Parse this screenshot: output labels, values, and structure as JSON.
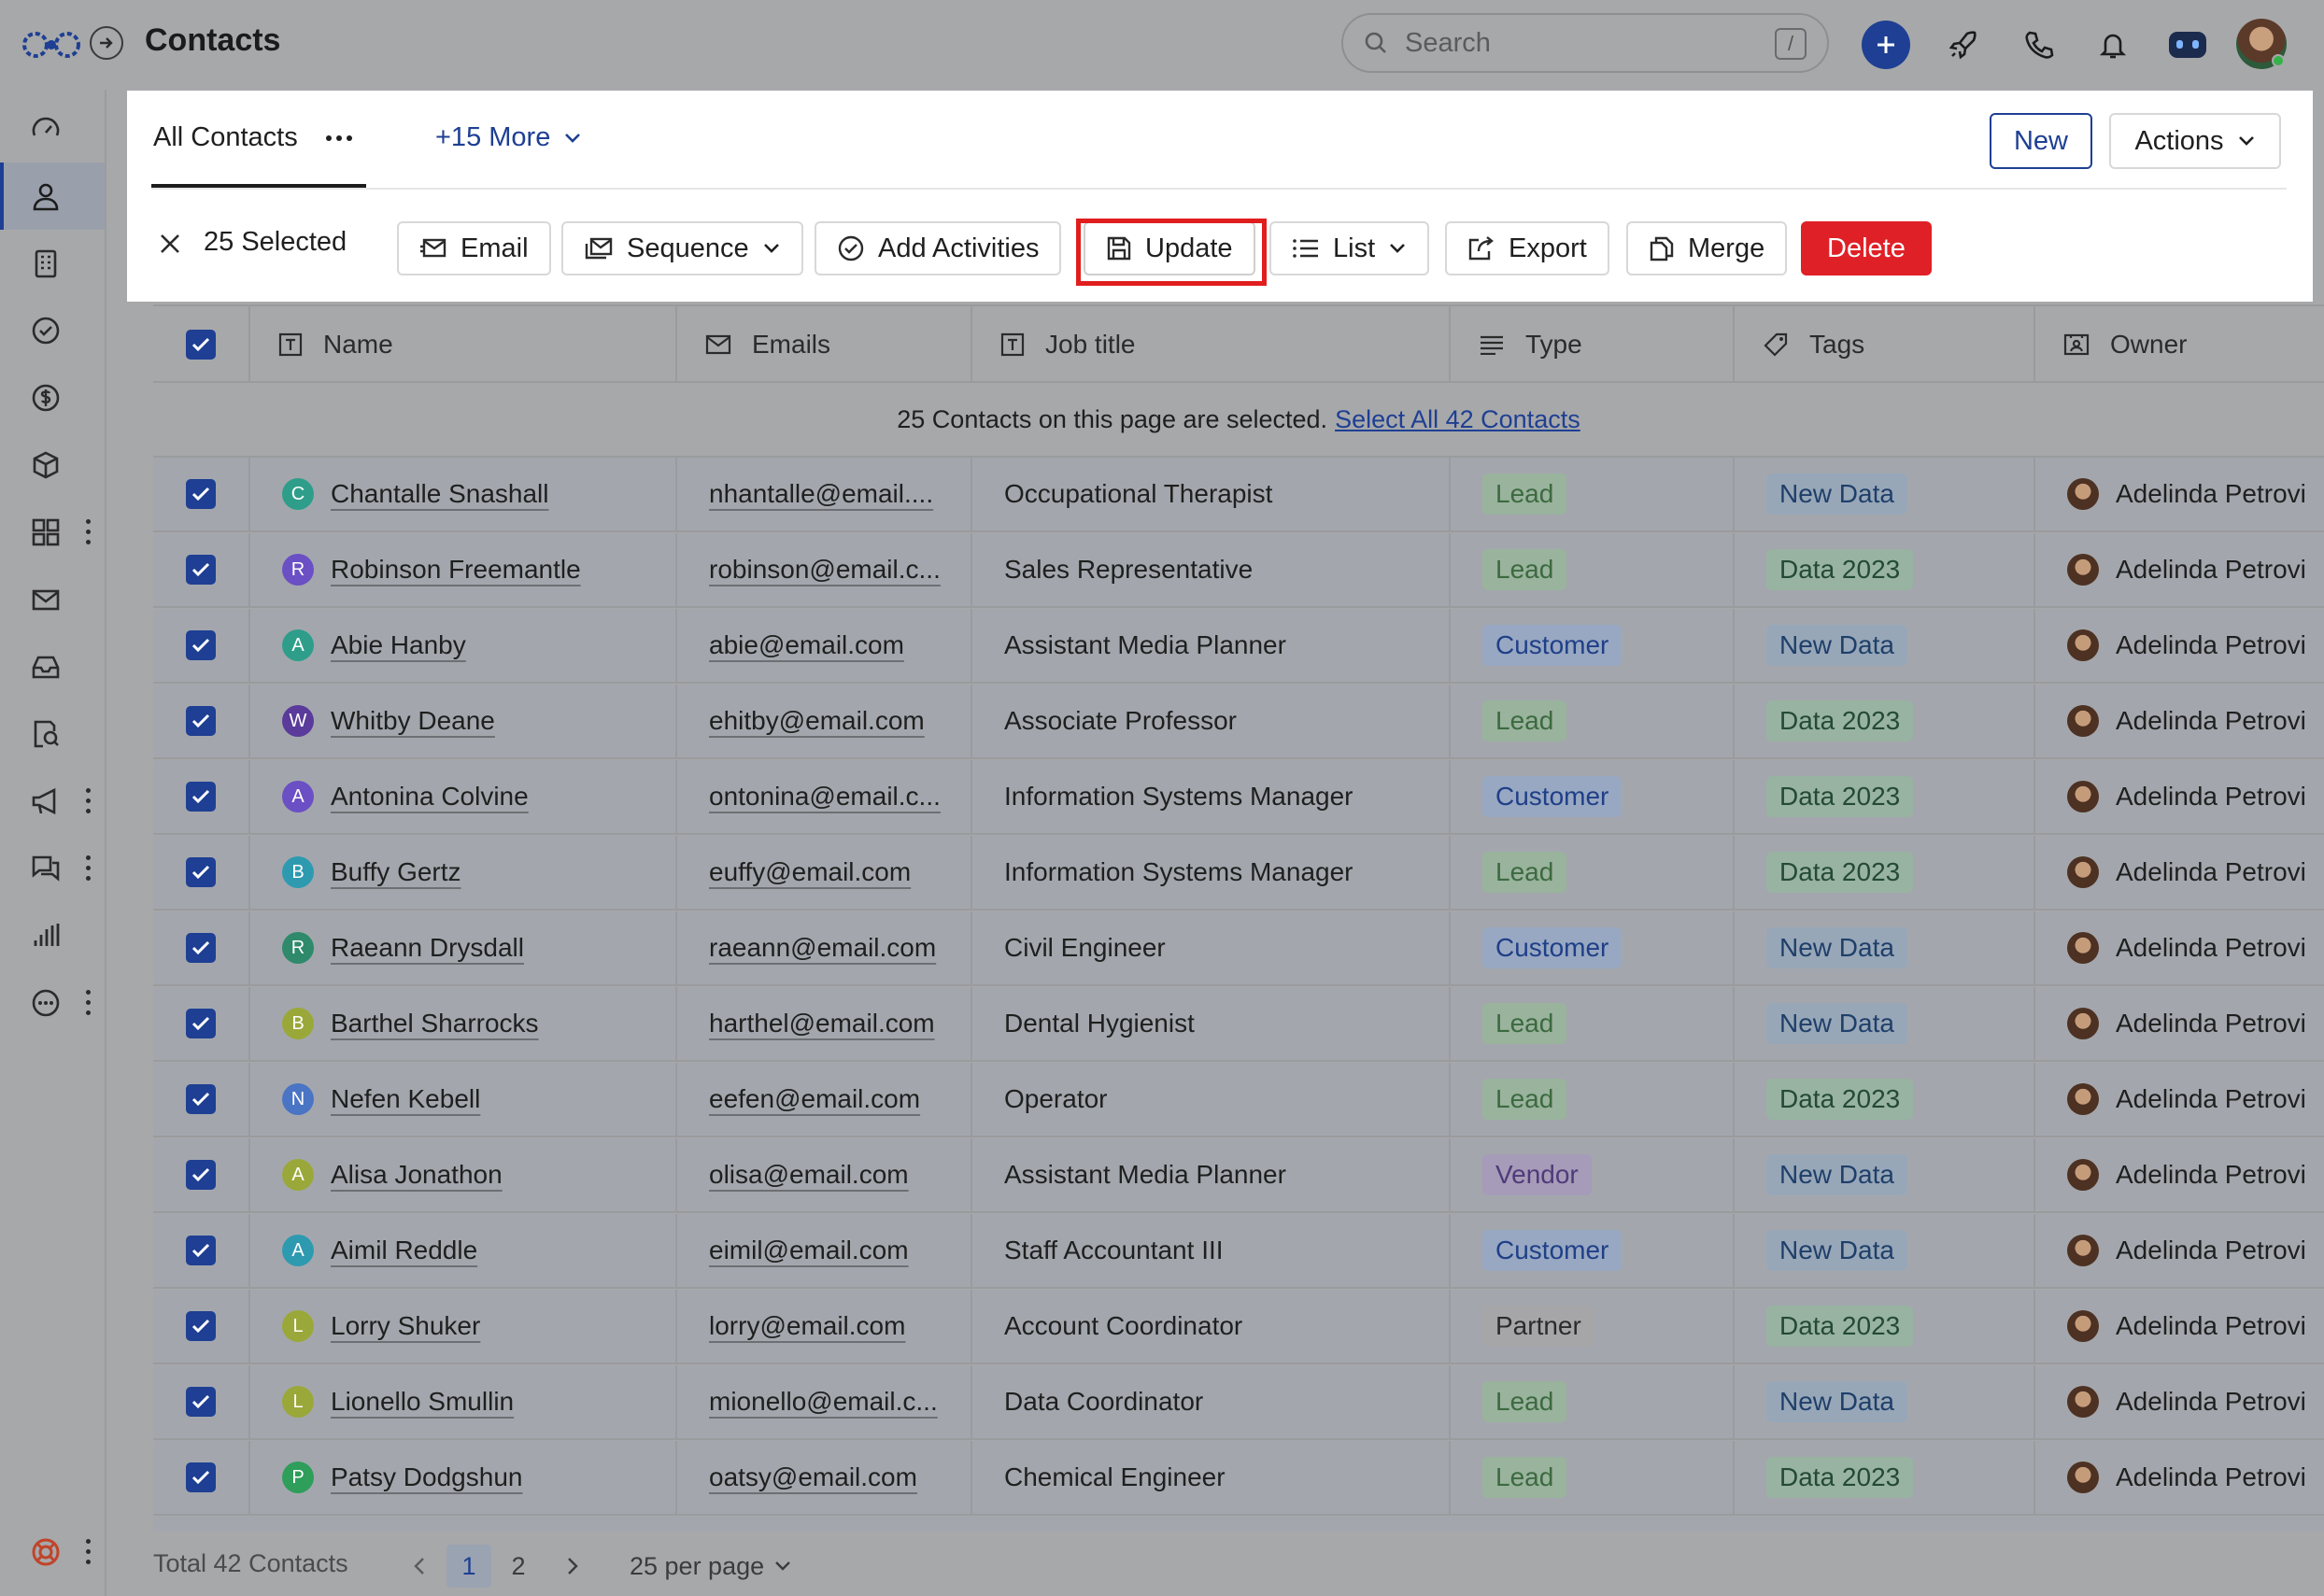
{
  "header": {
    "title": "Contacts",
    "search_placeholder": "Search",
    "search_shortcut": "/"
  },
  "tabs": {
    "current": "All Contacts",
    "more": "+15 More"
  },
  "toolbar": {
    "new_label": "New",
    "actions_label": "Actions"
  },
  "selection": {
    "count_label": "25 Selected",
    "buttons": {
      "email": "Email",
      "sequence": "Sequence",
      "add_activities": "Add Activities",
      "update": "Update",
      "list": "List",
      "export": "Export",
      "merge": "Merge",
      "delete": "Delete"
    },
    "notice_text": "25 Contacts on this page are selected.",
    "notice_link": "Select All 42 Contacts"
  },
  "table": {
    "columns": {
      "name": "Name",
      "emails": "Emails",
      "job_title": "Job title",
      "type": "Type",
      "tags": "Tags",
      "owner": "Owner"
    },
    "rows": [
      {
        "initial": "C",
        "color": "#2e9e8a",
        "name": "Chantalle Snashall",
        "email": "nhantalle@email....",
        "job": "Occupational Therapist",
        "type": "Lead",
        "tag": "New Data",
        "owner": "Adelinda Petrovi"
      },
      {
        "initial": "R",
        "color": "#6b4fc4",
        "name": "Robinson Freemantle",
        "email": "robinson@email.c...",
        "job": "Sales Representative",
        "type": "Lead",
        "tag": "Data 2023",
        "owner": "Adelinda Petrovi"
      },
      {
        "initial": "A",
        "color": "#2e9e8a",
        "name": "Abie Hanby",
        "email": "abie@email.com",
        "job": "Assistant Media Planner",
        "type": "Customer",
        "tag": "New Data",
        "owner": "Adelinda Petrovi"
      },
      {
        "initial": "W",
        "color": "#5a3a9a",
        "name": "Whitby Deane",
        "email": "ehitby@email.com",
        "job": "Associate Professor",
        "type": "Lead",
        "tag": "Data 2023",
        "owner": "Adelinda Petrovi"
      },
      {
        "initial": "A",
        "color": "#6b4fc4",
        "name": "Antonina Colvine",
        "email": "ontonina@email.c...",
        "job": "Information Systems Manager",
        "type": "Customer",
        "tag": "Data 2023",
        "owner": "Adelinda Petrovi"
      },
      {
        "initial": "B",
        "color": "#2e9ab0",
        "name": "Buffy Gertz",
        "email": "euffy@email.com",
        "job": "Information Systems Manager",
        "type": "Lead",
        "tag": "Data 2023",
        "owner": "Adelinda Petrovi"
      },
      {
        "initial": "R",
        "color": "#2e8a6a",
        "name": "Raeann Drysdall",
        "email": "raeann@email.com",
        "job": "Civil Engineer",
        "type": "Customer",
        "tag": "New Data",
        "owner": "Adelinda Petrovi"
      },
      {
        "initial": "B",
        "color": "#9aa83a",
        "name": "Barthel Sharrocks",
        "email": "harthel@email.com",
        "job": "Dental Hygienist",
        "type": "Lead",
        "tag": "New Data",
        "owner": "Adelinda Petrovi"
      },
      {
        "initial": "N",
        "color": "#4a74c4",
        "name": "Nefen Kebell",
        "email": "eefen@email.com",
        "job": "Operator",
        "type": "Lead",
        "tag": "Data 2023",
        "owner": "Adelinda Petrovi"
      },
      {
        "initial": "A",
        "color": "#9aa83a",
        "name": "Alisa Jonathon",
        "email": "olisa@email.com",
        "job": "Assistant Media Planner",
        "type": "Vendor",
        "tag": "New Data",
        "owner": "Adelinda Petrovi"
      },
      {
        "initial": "A",
        "color": "#2e9ab0",
        "name": "Aimil Reddle",
        "email": "eimil@email.com",
        "job": "Staff Accountant III",
        "type": "Customer",
        "tag": "New Data",
        "owner": "Adelinda Petrovi"
      },
      {
        "initial": "L",
        "color": "#9aa83a",
        "name": "Lorry Shuker",
        "email": "lorry@email.com",
        "job": "Account Coordinator",
        "type": "Partner",
        "tag": "Data 2023",
        "owner": "Adelinda Petrovi"
      },
      {
        "initial": "L",
        "color": "#9aa83a",
        "name": "Lionello Smullin",
        "email": "mionello@email.c...",
        "job": "Data Coordinator",
        "type": "Lead",
        "tag": "New Data",
        "owner": "Adelinda Petrovi"
      },
      {
        "initial": "P",
        "color": "#2e9e5a",
        "name": "Patsy Dodgshun",
        "email": "oatsy@email.com",
        "job": "Chemical Engineer",
        "type": "Lead",
        "tag": "Data 2023",
        "owner": "Adelinda Petrovi"
      }
    ]
  },
  "footer": {
    "total": "Total 42 Contacts",
    "page_1": "1",
    "page_2": "2",
    "per_page": "25 per page"
  }
}
